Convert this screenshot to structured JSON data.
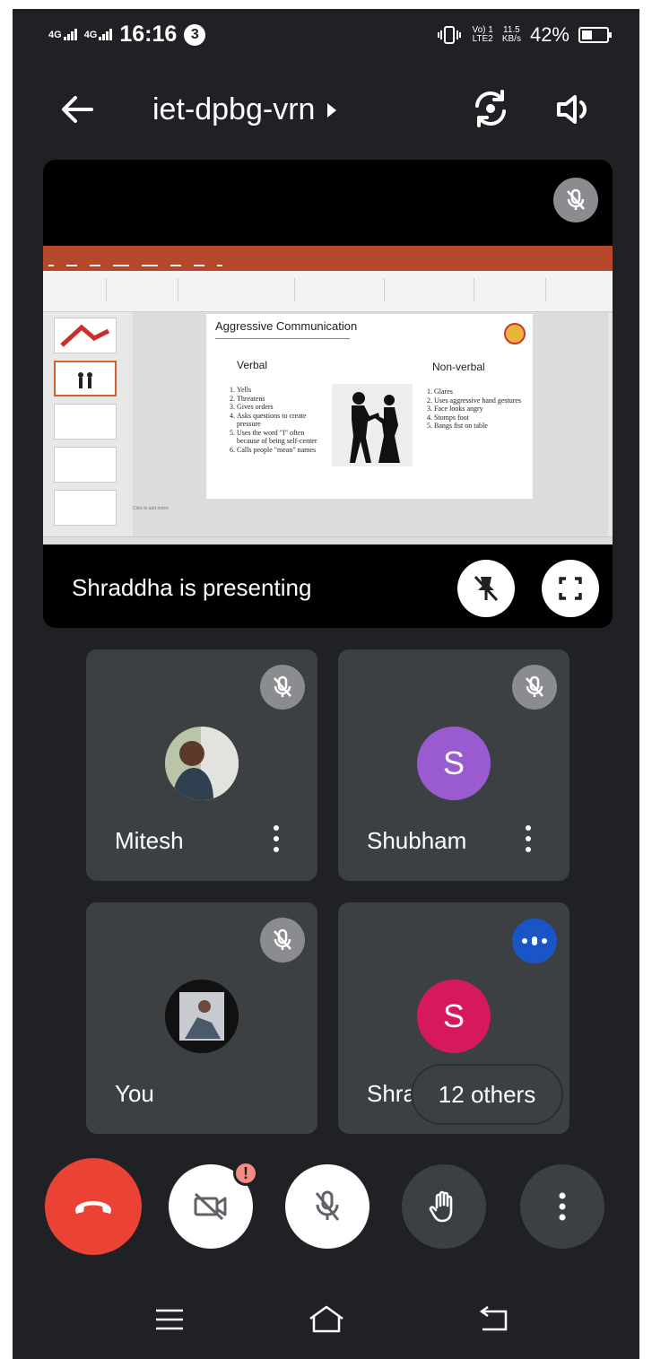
{
  "status_bar": {
    "network_1": "4G",
    "network_2": "4G",
    "time": "16:16",
    "notification_count": "3",
    "volte_line1": "Vo) 1",
    "volte_line2": "LTE2",
    "speed_value": "11.5",
    "speed_unit": "KB/s",
    "battery": "42%"
  },
  "header": {
    "meeting_code": "iet-dpbg-vrn",
    "icons": [
      "back-arrow-icon",
      "caret-right-icon",
      "switch-camera-icon",
      "speaker-icon"
    ]
  },
  "presentation": {
    "presenter_text": "Shraddha is presenting",
    "slide": {
      "title": "Aggressive Communication",
      "verbal_heading": "Verbal",
      "nonverbal_heading": "Non-verbal",
      "verbal_items": [
        "Yells",
        "Threatens",
        "Gives orders",
        "Asks questions to create pressure",
        "Uses the word \"I\" often because of being self-center",
        "Calls people \"mean\" names"
      ],
      "nonverbal_items": [
        "Glares",
        "Uses aggressive hand gestures",
        "Face looks angry",
        "Stomps foot",
        "Bangs fist on table"
      ],
      "notes_placeholder": "Click to add notes"
    }
  },
  "participants": [
    {
      "name": "Mitesh",
      "avatar": "photo",
      "muted": true
    },
    {
      "name": "Shubham",
      "avatar_letter": "S",
      "avatar_color": "#9a5bd1",
      "muted": true
    },
    {
      "name": "You",
      "avatar": "photo",
      "muted": true
    },
    {
      "name": "Shra",
      "avatar_letter": "S",
      "avatar_color": "#d5195c",
      "speaking": true
    }
  ],
  "others_label": "12 others",
  "controls": {
    "warning_badge": "!",
    "items": [
      "end-call-icon",
      "camera-off-icon",
      "mic-off-icon",
      "raise-hand-icon",
      "more-options-icon"
    ]
  },
  "colors": {
    "background": "#202124",
    "tile": "#3c4043",
    "hangup": "#ea4335",
    "speaking": "#1a55c7"
  }
}
